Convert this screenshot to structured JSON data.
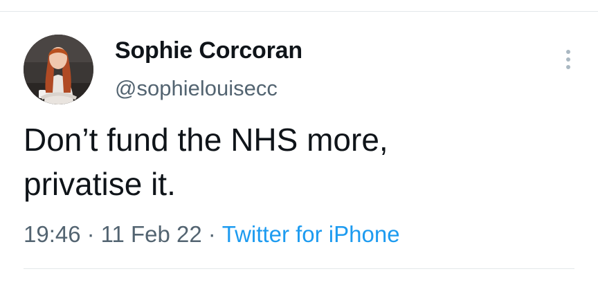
{
  "author": {
    "display_name": "Sophie Corcoran",
    "handle": "@sophielouisecc",
    "avatar_icon": "profile-photo"
  },
  "tweet": {
    "text_lines": [
      "Don’t fund the NHS more,",
      "privatise it."
    ],
    "time": "19:46",
    "date": "11 Feb 22",
    "separator": "·",
    "source": "Twitter for iPhone"
  },
  "more_menu_icon": "more-vertical-icon",
  "colors": {
    "text_primary": "#0f1419",
    "text_secondary": "#536471",
    "link": "#1d9bf0",
    "divider": "#e3e7ea"
  }
}
